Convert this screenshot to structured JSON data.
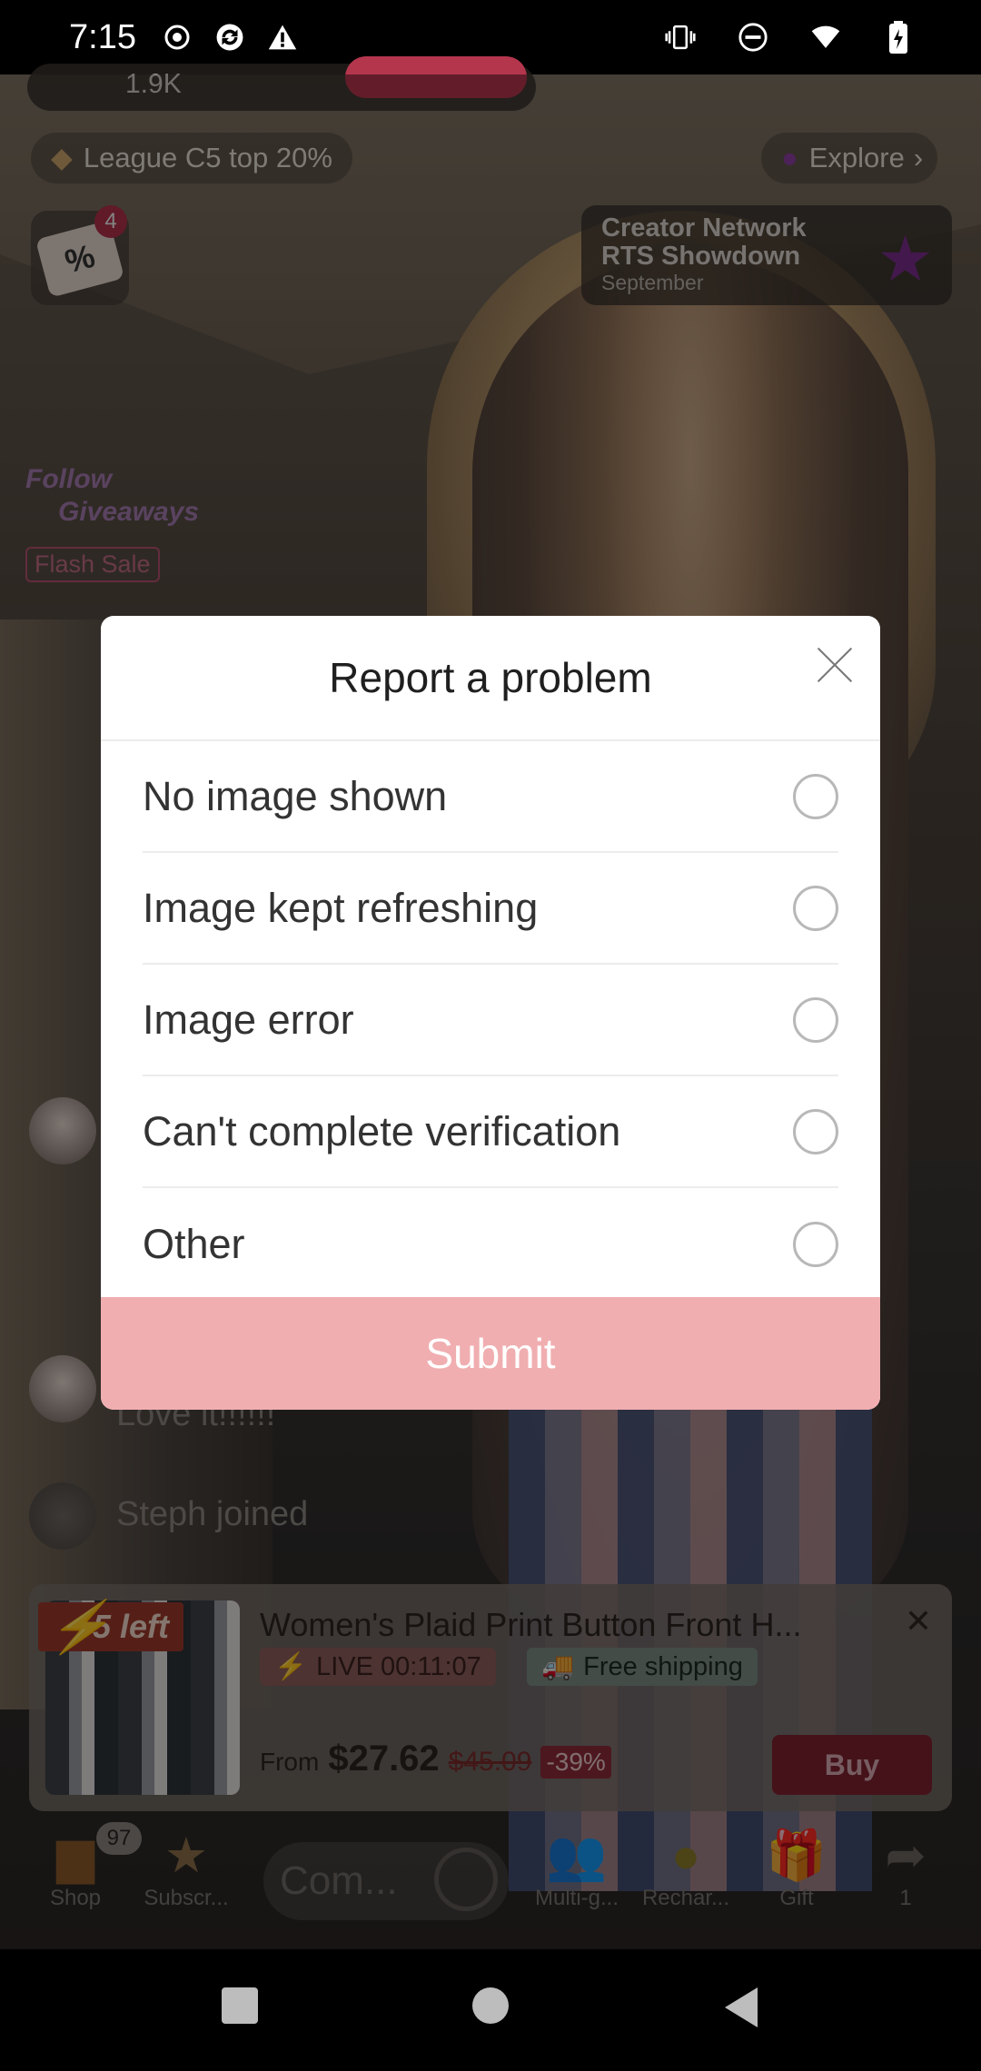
{
  "status_bar": {
    "time": "7:15"
  },
  "stream": {
    "host_likes": "1.9K",
    "league": "League C5 top 20%",
    "explore": "Explore",
    "coupon_count": "4",
    "coupon_symbol": "%",
    "creator_event": {
      "line1": "Creator Network",
      "line2": "RTS Showdown",
      "line3": "September"
    },
    "promo_lines": [
      "Follow",
      "Giveaways"
    ],
    "flash_sale": "Flash Sale",
    "chat": [
      {
        "text": "Love it!!!!!!"
      },
      {
        "text": "Steph joined"
      }
    ]
  },
  "product": {
    "badge": "5 left",
    "title": "Women's Plaid Print Button Front H...",
    "live_timer": "LIVE 00:11:07",
    "shipping": "Free shipping",
    "price_prefix": "From",
    "price": "$27.62",
    "original_price": "$45.09",
    "discount": "-39%",
    "buy_label": "Buy"
  },
  "toolbar": {
    "shop_count": "97",
    "shop": "Shop",
    "subscribe": "Subscr...",
    "comment_placeholder": "Com...",
    "multi_guest": "Multi-g...",
    "recharge": "Rechar...",
    "gift": "Gift",
    "share_count": "1"
  },
  "dialog": {
    "title": "Report a problem",
    "options": [
      "No image shown",
      "Image kept refreshing",
      "Image error",
      "Can't complete verification",
      "Other"
    ],
    "submit": "Submit"
  },
  "colors": {
    "submit_bg": "#f0aeb0",
    "accent": "#b4364d"
  }
}
